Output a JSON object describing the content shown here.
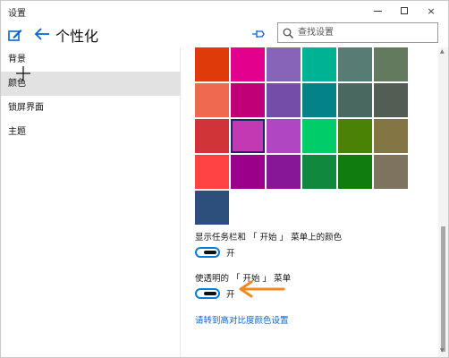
{
  "window": {
    "app_title": "设置",
    "controls": {
      "minimize": "",
      "maximize": "",
      "close": "×"
    }
  },
  "header": {
    "title": "个性化",
    "search": {
      "placeholder": "查找设置",
      "value": ""
    }
  },
  "sidebar": {
    "items": [
      {
        "label": "背景"
      },
      {
        "label": "颜色",
        "selected": true
      },
      {
        "label": "锁屏界面"
      },
      {
        "label": "主题"
      }
    ]
  },
  "colors": {
    "selected_index": 13,
    "swatches": [
      "#dd3b0a",
      "#e3008c",
      "#8764b8",
      "#00b294",
      "#567c73",
      "#637a5e",
      "#ef6950",
      "#bf0077",
      "#744da9",
      "#038387",
      "#486860",
      "#525e54",
      "#d13438",
      "#c239b3",
      "#b146c2",
      "#00cc6a",
      "#498205",
      "#847545",
      "#ff4343",
      "#9a0089",
      "#881798",
      "#10893e",
      "#107c10",
      "#7e735f",
      "#2d4f7c"
    ]
  },
  "settings": {
    "taskbar_color": {
      "label": "显示任务栏和 「 开始 」 菜单上的颜色",
      "state": "开"
    },
    "transparent_start": {
      "label": "使透明的 「 开始 」 菜单",
      "state": "开"
    },
    "high_contrast_link": "请转到高对比度颜色设置"
  },
  "accent_colors": {
    "toggle_blue": "#0a7bd8",
    "link_blue": "#0a63c9",
    "arrow_orange": "#f08a1c"
  }
}
